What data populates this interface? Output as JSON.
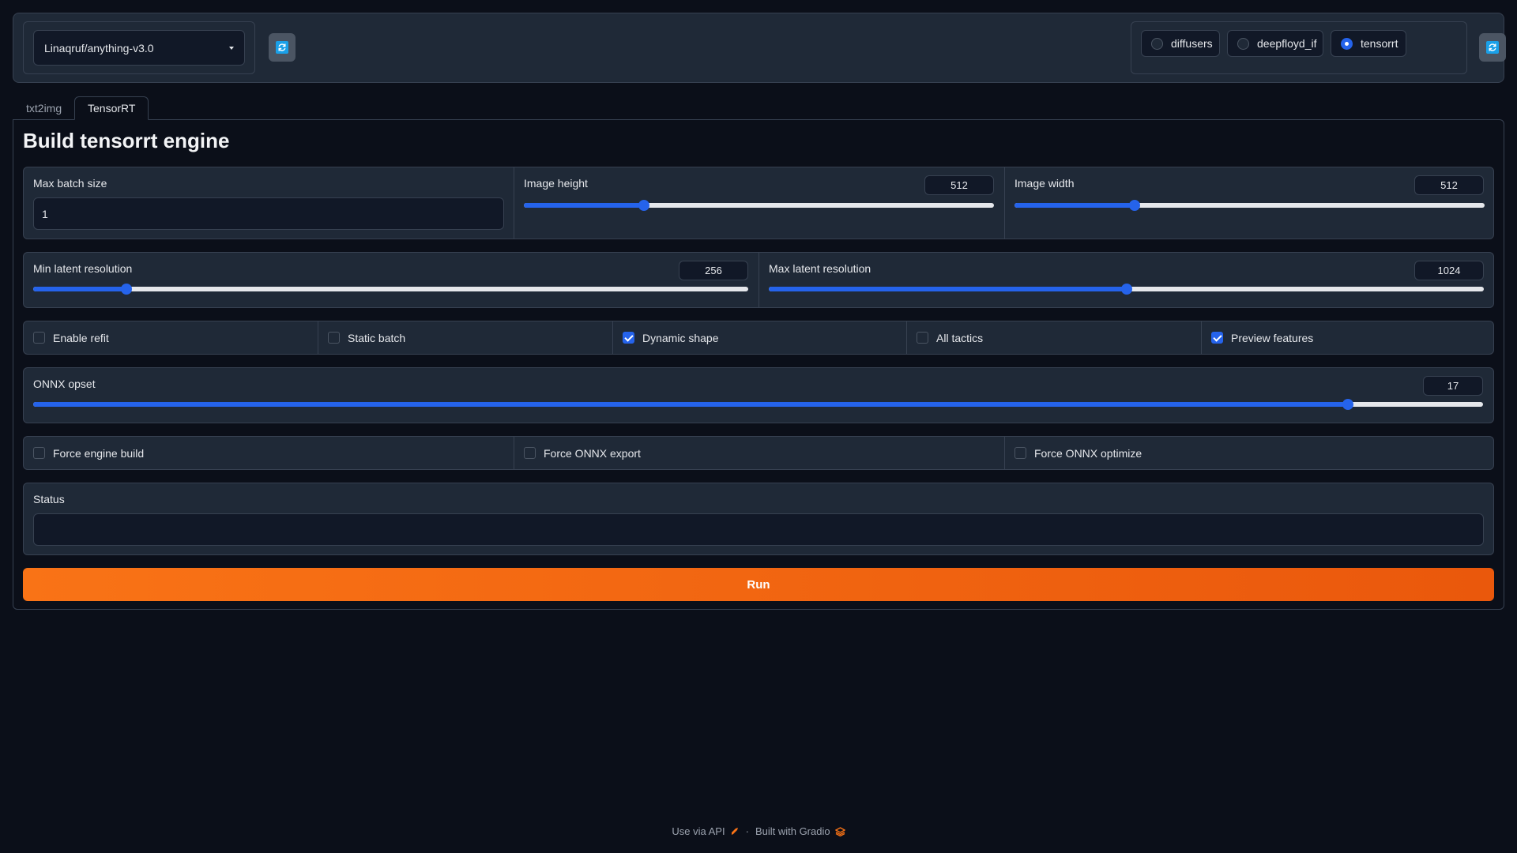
{
  "header": {
    "model_value": "Linaqruf/anything-v3.0",
    "backends": [
      {
        "label": "diffusers",
        "selected": false
      },
      {
        "label": "deepfloyd_if",
        "selected": false
      },
      {
        "label": "tensorrt",
        "selected": true
      }
    ]
  },
  "tabs": [
    {
      "label": "txt2img",
      "active": false
    },
    {
      "label": "TensorRT",
      "active": true
    }
  ],
  "main": {
    "title": "Build tensorrt engine",
    "max_batch_size": {
      "label": "Max batch size",
      "value": "1"
    },
    "image_height": {
      "label": "Image height",
      "value": "512",
      "fraction": 0.255
    },
    "image_width": {
      "label": "Image width",
      "value": "512",
      "fraction": 0.255
    },
    "min_latent": {
      "label": "Min latent resolution",
      "value": "256",
      "fraction": 0.13
    },
    "max_latent": {
      "label": "Max latent resolution",
      "value": "1024",
      "fraction": 0.5
    },
    "checkboxes": [
      {
        "label": "Enable refit",
        "checked": false
      },
      {
        "label": "Static batch",
        "checked": false
      },
      {
        "label": "Dynamic shape",
        "checked": true
      },
      {
        "label": "All tactics",
        "checked": false
      },
      {
        "label": "Preview features",
        "checked": true
      }
    ],
    "onnx_opset": {
      "label": "ONNX opset",
      "value": "17",
      "fraction": 0.907
    },
    "force_options": [
      {
        "label": "Force engine build",
        "checked": false
      },
      {
        "label": "Force ONNX export",
        "checked": false
      },
      {
        "label": "Force ONNX optimize",
        "checked": false
      }
    ],
    "status": {
      "label": "Status",
      "value": ""
    },
    "run_label": "Run"
  },
  "footer": {
    "api_link": "Use via API",
    "separator": "·",
    "built_with": "Built with Gradio"
  },
  "colors": {
    "accent": "#2563eb",
    "run_button": "#f97316",
    "background": "#0b0f19",
    "block": "#1f2937"
  }
}
